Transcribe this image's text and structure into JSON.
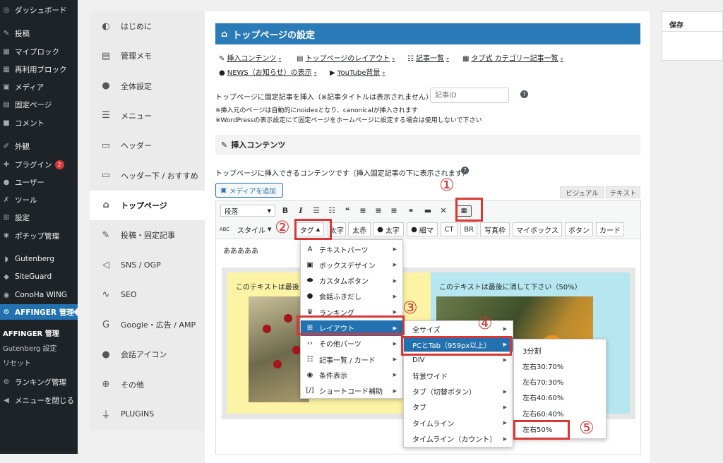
{
  "wp_menu": {
    "items": [
      {
        "label": "ダッシュボード",
        "icon": "dashboard-icon",
        "glyph": "◎"
      },
      {
        "label": "投稿",
        "icon": "pin-icon",
        "glyph": "✎"
      },
      {
        "label": "マイブロック",
        "icon": "blocks-icon",
        "glyph": "▦"
      },
      {
        "label": "再利用ブロック",
        "icon": "blocks-icon",
        "glyph": "▦"
      },
      {
        "label": "メディア",
        "icon": "media-icon",
        "glyph": "▣"
      },
      {
        "label": "固定ページ",
        "icon": "page-icon",
        "glyph": "▤"
      },
      {
        "label": "コメント",
        "icon": "comment-icon",
        "glyph": "■"
      },
      {
        "label": "外観",
        "icon": "brush-icon",
        "glyph": "✐"
      },
      {
        "label": "プラグイン",
        "icon": "plugin-icon",
        "glyph": "✚",
        "badge": "2"
      },
      {
        "label": "ユーザー",
        "icon": "user-icon",
        "glyph": "●"
      },
      {
        "label": "ツール",
        "icon": "wrench-icon",
        "glyph": "✗"
      },
      {
        "label": "設定",
        "icon": "settings-icon",
        "glyph": "⊞"
      },
      {
        "label": "ポチップ管理",
        "icon": "paw-icon",
        "glyph": "✱"
      },
      {
        "label": "Gutenberg",
        "icon": "gutenberg-icon",
        "glyph": "◗"
      },
      {
        "label": "SiteGuard",
        "icon": "shield-icon",
        "glyph": "◆"
      },
      {
        "label": "ConoHa WING",
        "icon": "conoha-icon",
        "glyph": "◉"
      },
      {
        "label": "AFFINGER 管理",
        "icon": "gear-icon",
        "glyph": "⚙",
        "active": true
      }
    ],
    "submenu": [
      "AFFINGER 管理",
      "Gutenberg 設定",
      "リセット"
    ],
    "after": [
      {
        "label": "ランキング管理",
        "icon": "gear-icon",
        "glyph": "⚙"
      },
      {
        "label": "メニューを閉じる",
        "icon": "collapse-icon",
        "glyph": "◀"
      }
    ]
  },
  "aff_nav": [
    {
      "label": "はじめに",
      "icon": "shield-icon",
      "glyph": "◐"
    },
    {
      "label": "管理メモ",
      "icon": "memo-icon",
      "glyph": "▤"
    },
    {
      "label": "全体設定",
      "icon": "palette-icon",
      "glyph": "●"
    },
    {
      "label": "メニュー",
      "icon": "menu-icon",
      "glyph": "☰"
    },
    {
      "label": "ヘッダー",
      "icon": "header-icon",
      "glyph": "▭"
    },
    {
      "label": "ヘッダー下 / おすすめ",
      "icon": "header-icon",
      "glyph": "▭"
    },
    {
      "label": "トップページ",
      "icon": "home-icon",
      "glyph": "⌂",
      "selected": true
    },
    {
      "label": "投稿・固定記事",
      "icon": "edit-icon",
      "glyph": "✎"
    },
    {
      "label": "SNS / OGP",
      "icon": "share-icon",
      "glyph": "◁"
    },
    {
      "label": "SEO",
      "icon": "chart-icon",
      "glyph": "∿"
    },
    {
      "label": "Google・広告 / AMP",
      "icon": "google-icon",
      "glyph": "G"
    },
    {
      "label": "会話アイコン",
      "icon": "chat-icon",
      "glyph": "●"
    },
    {
      "label": "その他",
      "icon": "plus-icon",
      "glyph": "⊕"
    },
    {
      "label": "PLUGINS",
      "icon": "plug-icon",
      "glyph": "⏚"
    }
  ],
  "main": {
    "title": "トップページの設定",
    "links": [
      "挿入コンテンツ",
      "トップページのレイアウト",
      "記事一覧",
      "タブ式 カテゴリー記事一覧",
      "NEWS（お知らせ）の表示",
      "YouTube背景"
    ],
    "fixed_label": "トップページに固定記事を挿入（※記事タイトルは表示されません）：",
    "fixed_placeholder": "記事ID",
    "note1": "※挿入元のページは自動的にnoidexとなり、canonicalが挿入されます",
    "note2": "※WordPressの表示設定にて固定ページをホームページに設定する場合は使用しないで下さい",
    "section": "挿入コンテンツ",
    "desc": "トップページに挿入できるコンテンツです（挿入固定記事の下に表示されます）",
    "add_media": "メディアを追加",
    "tab_visual": "ビジュアル",
    "tab_text": "テキスト"
  },
  "toolbar": {
    "format": "段落",
    "row2": [
      "スタイル",
      "タグ",
      "太字",
      "太赤",
      "太字",
      "細マ",
      "CT",
      "BR",
      "写真枠",
      "マイボックス",
      "ボタン",
      "カード"
    ]
  },
  "content": {
    "line": "あああああ",
    "col1_text": "このテキストは最後に",
    "col2_text": "このテキストは最後に消して下さい（50%）"
  },
  "menu1": [
    {
      "label": "テキストパーツ",
      "glyph": "A"
    },
    {
      "label": "ボックスデザイン",
      "glyph": "▣"
    },
    {
      "label": "カスタムボタン",
      "glyph": "⬬"
    },
    {
      "label": "会話ふきだし",
      "glyph": "●"
    },
    {
      "label": "ランキング",
      "glyph": "♛"
    },
    {
      "label": "レイアウト",
      "glyph": "⊞",
      "highlight": true
    },
    {
      "label": "その他パーツ",
      "glyph": "‹›"
    },
    {
      "label": "記事一覧 / カード",
      "glyph": "☷"
    },
    {
      "label": "条件表示",
      "glyph": "◉"
    },
    {
      "label": "ショートコード補助",
      "glyph": "[/]"
    }
  ],
  "menu2": [
    {
      "label": "全サイズ"
    },
    {
      "label": "PCとTab（959px以上）",
      "highlight": true
    }
  ],
  "menu3": [
    "DIV",
    "背景ワイド",
    "タブ（切替ボタン）",
    "タブ",
    "タイムライン",
    "タイムライン（カウント）"
  ],
  "menu4": [
    "3分割",
    "左右30:70%",
    "左右70:30%",
    "左右40:60%",
    "左右60:40%",
    "左右50%"
  ],
  "markers": [
    "①",
    "②",
    "③",
    "④",
    "⑤"
  ],
  "save": "保存",
  "accent": "#d93636",
  "brand": "#2271b1"
}
